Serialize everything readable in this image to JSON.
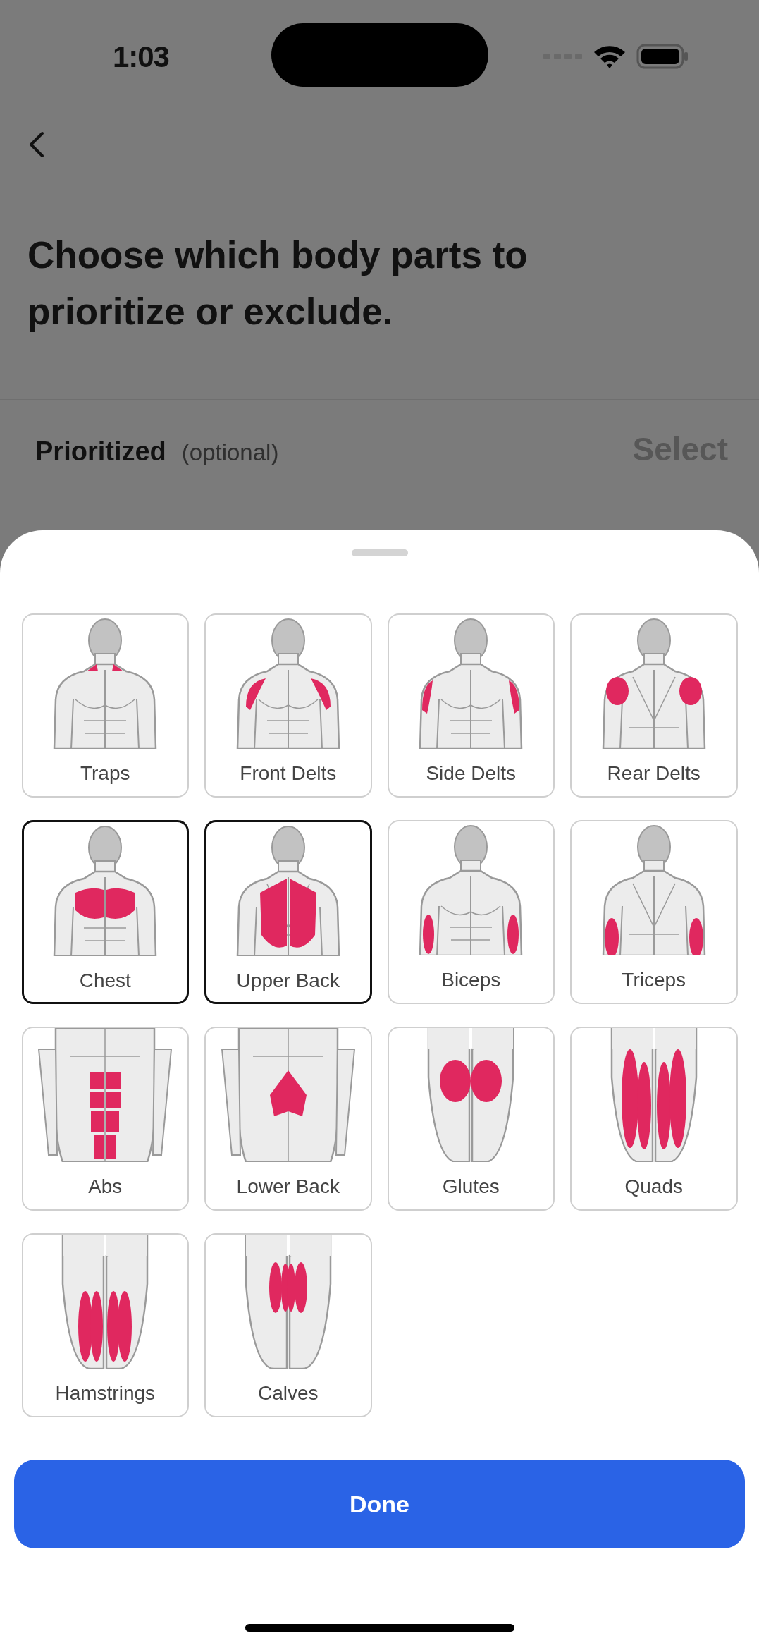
{
  "status_bar": {
    "time": "1:03"
  },
  "header": {
    "title": "Choose which body parts to prioritize or exclude."
  },
  "section": {
    "title": "Prioritized",
    "note": "(optional)",
    "action": "Select"
  },
  "sheet": {
    "items": [
      {
        "label": "Traps",
        "kind": "traps",
        "selected": false
      },
      {
        "label": "Front Delts",
        "kind": "front-delts",
        "selected": false
      },
      {
        "label": "Side Delts",
        "kind": "side-delts",
        "selected": false
      },
      {
        "label": "Rear Delts",
        "kind": "rear-delts",
        "selected": false
      },
      {
        "label": "Chest",
        "kind": "chest",
        "selected": true
      },
      {
        "label": "Upper Back",
        "kind": "upper-back",
        "selected": true
      },
      {
        "label": "Biceps",
        "kind": "biceps",
        "selected": false
      },
      {
        "label": "Triceps",
        "kind": "triceps",
        "selected": false
      },
      {
        "label": "Abs",
        "kind": "abs",
        "selected": false
      },
      {
        "label": "Lower Back",
        "kind": "lower-back",
        "selected": false
      },
      {
        "label": "Glutes",
        "kind": "glutes",
        "selected": false
      },
      {
        "label": "Quads",
        "kind": "quads",
        "selected": false
      },
      {
        "label": "Hamstrings",
        "kind": "hamstrings",
        "selected": false
      },
      {
        "label": "Calves",
        "kind": "calves",
        "selected": false
      }
    ],
    "done_button": "Done"
  }
}
